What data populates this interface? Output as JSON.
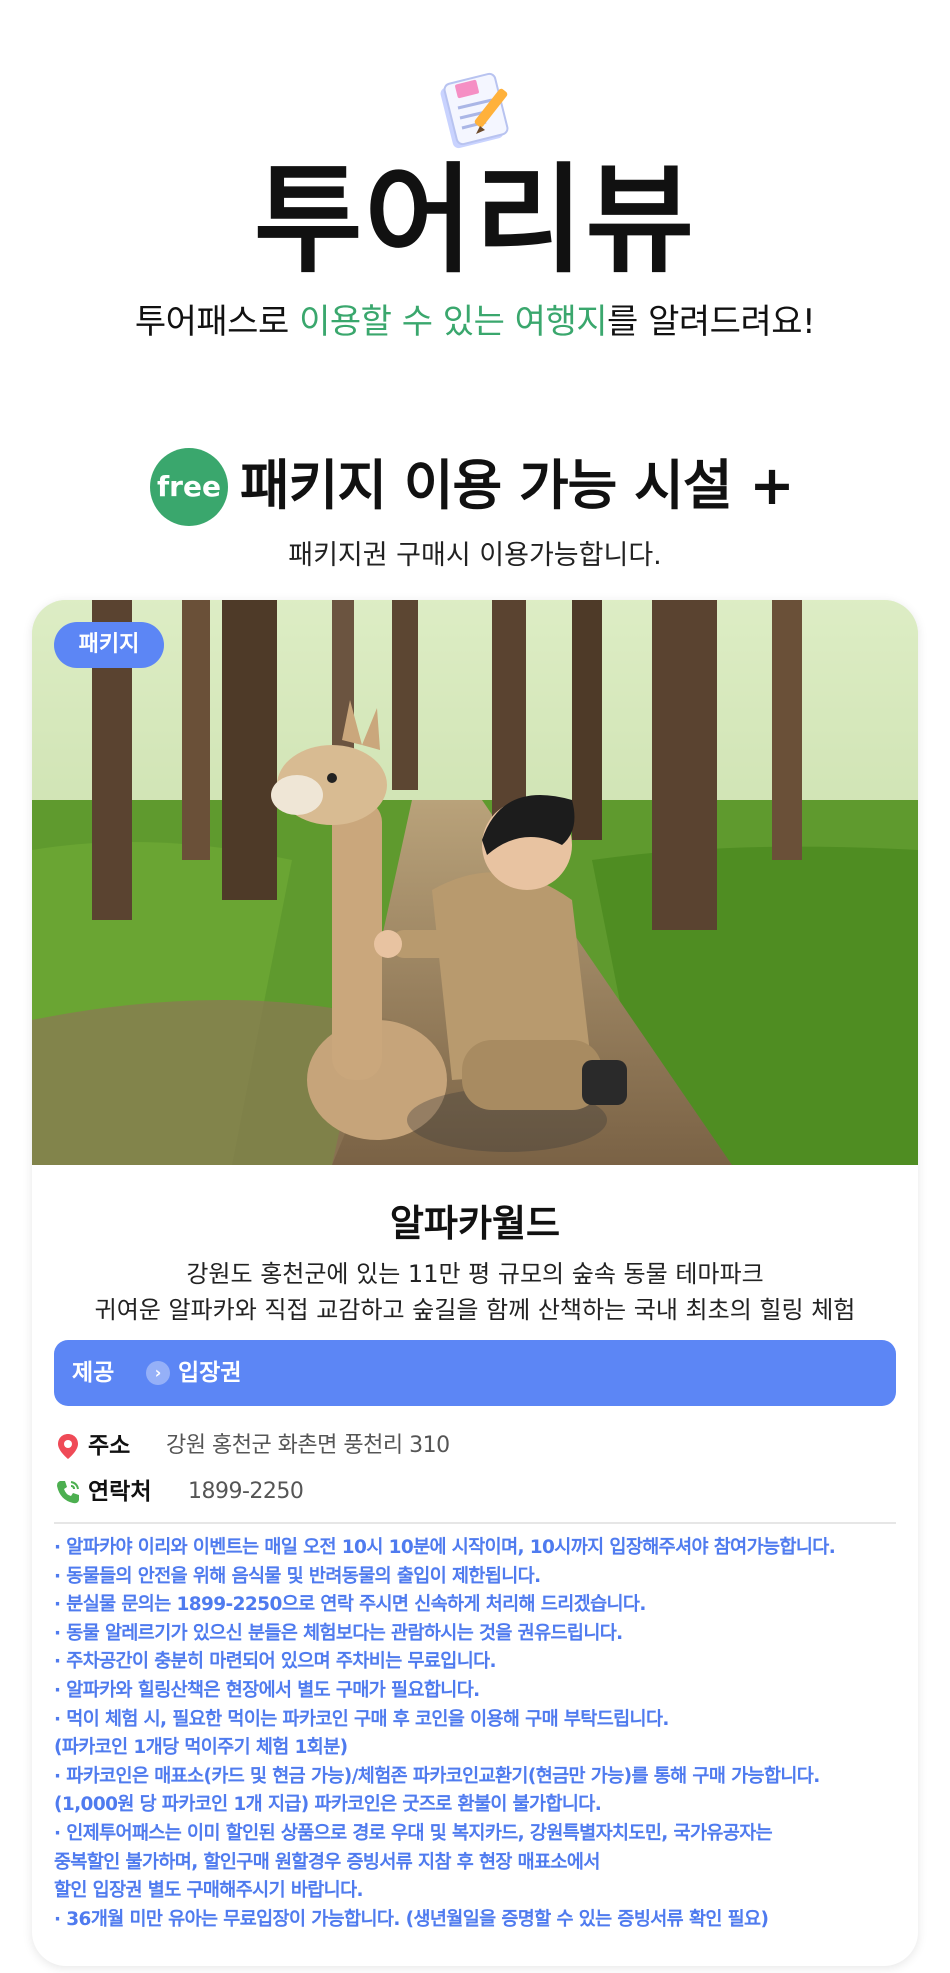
{
  "hero": {
    "icon": "memo-pencil-icon",
    "title": "투어리뷰",
    "subtitle_pre": "투어패스로 ",
    "subtitle_highlight": "이용할 수 있는 여행지",
    "subtitle_post": "를 알려드려요!",
    "highlight_color": "#3aa76d"
  },
  "section": {
    "badge": "free",
    "title": "패키지 이용 가능 시설 +",
    "subtitle": "패키지권 구매시 이용가능합니다."
  },
  "card": {
    "photo_tag": "패키지",
    "photo_description_icon": "photo-boy-with-alpaca",
    "name": "알파카월드",
    "desc_line1": "강원도 홍천군에 있는 11만 평 규모의 숲속 동물 테마파크",
    "desc_line2": "귀여운 알파카와 직접 교감하고 숲길을 함께 산책하는 국내 최초의 힐링 체험",
    "provide_label": "제공",
    "provide_value": "입장권",
    "address_label": "주소",
    "address_value": "강원 홍천군 화촌면 풍천리 310",
    "tel_label": "연락처",
    "tel_value": "1899-2250",
    "accent_color": "#5c86f5",
    "notes": [
      "· 알파카야 이리와 이벤트는 매일 오전 10시 10분에 시작이며, 10시까지 입장해주셔야 참여가능합니다.",
      "· 동물들의 안전을 위해 음식물 및 반려동물의 출입이 제한됩니다.",
      "· 분실물 문의는 1899-2250으로 연락 주시면 신속하게 처리해 드리겠습니다.",
      "· 동물 알레르기가 있으신 분들은 체험보다는 관람하시는 것을 권유드립니다.",
      "· 주차공간이 충분히 마련되어 있으며 주차비는 무료입니다.",
      "· 알파카와 힐링산책은 현장에서 별도 구매가 필요합니다.",
      "· 먹이 체험 시, 필요한 먹이는 파카코인 구매 후 코인을 이용해 구매 부탁드립니다.",
      "   (파카코인 1개당 먹이주기 체험 1회분)",
      "· 파카코인은 매표소(카드 및 현금 가능)/체험존 파카코인교환기(현금만 가능)를 통해 구매 가능합니다.",
      "   (1,000원 당 파카코인 1개 지급) 파카코인은 굿즈로 환불이 불가합니다.",
      "· 인제투어패스는 이미 할인된 상품으로 경로 우대 및 복지카드, 강원특별자치도민, 국가유공자는",
      "   중복할인 불가하며,  할인구매 원할경우 증빙서류 지참 후 현장 매표소에서",
      "   할인 입장권 별도 구매해주시기 바랍니다.",
      "· 36개월 미만 유아는 무료입장이 가능합니다. (생년월일을 증명할 수 있는 증빙서류 확인 필요)"
    ]
  }
}
